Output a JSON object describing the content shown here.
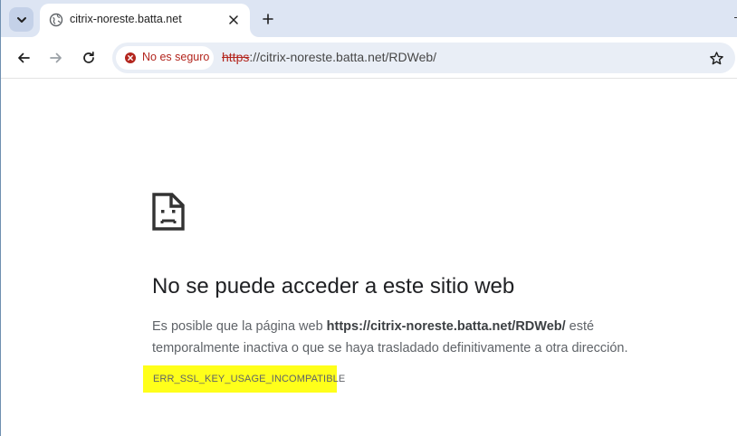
{
  "tab": {
    "title": "citrix-noreste.batta.net"
  },
  "toolbar": {
    "security_label": "No es seguro",
    "url_scheme": "https",
    "url_rest": "://citrix-noreste.batta.net/RDWeb/"
  },
  "error": {
    "title": "No se puede acceder a este sitio web",
    "desc_prefix": "Es posible que la página web ",
    "desc_url": "https://citrix-noreste.batta.net/RDWeb/",
    "desc_line1_suffix": " esté",
    "desc_line2": "temporalmente inactiva o que se haya trasladado definitivamente a otra dirección.",
    "code": "ERR_SSL_KEY_USAGE_INCOMPATIBLE"
  },
  "icons": {
    "tab_search": "chevron-down-icon",
    "favicon": "globe-icon",
    "close": "close-icon",
    "new_tab": "plus-icon",
    "back": "arrow-left-icon",
    "forward": "arrow-right-icon",
    "reload": "reload-icon",
    "security": "error-circle-icon",
    "bookmark": "star-icon",
    "sad_page": "sad-page-icon"
  },
  "colors": {
    "tabstrip": "#dde5f3",
    "omnibox": "#e9eef6",
    "insecure_red": "#b3261e",
    "highlight": "#ffff1a"
  }
}
